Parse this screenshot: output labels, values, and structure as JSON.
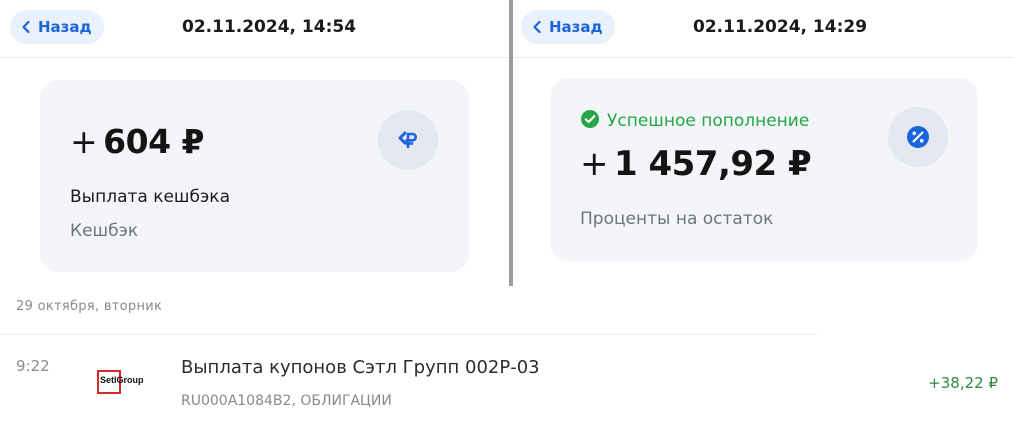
{
  "left_receipt": {
    "back_label": "Назад",
    "datetime": "02.11.2024, 14:54",
    "amount_sign": "+",
    "amount": "604 ₽",
    "icon": "cashback-ruble-icon",
    "description": "Выплата кешбэка",
    "category": "Кешбэк"
  },
  "right_receipt": {
    "back_label": "Назад",
    "datetime": "02.11.2024, 14:29",
    "status": "Успешное пополнение",
    "amount_sign": "+",
    "amount": "1 457,92 ₽",
    "icon": "percent-icon",
    "description": "Проценты на остаток"
  },
  "history": {
    "date_header": "29 октября, вторник",
    "transaction": {
      "time": "9:22",
      "logo_text": "SetlGroup",
      "title": "Выплата купонов Сэтл Групп 002Р-03",
      "subtitle": "RU000A1084B2, ОБЛИГАЦИИ",
      "amount": "+38,22 ₽"
    }
  },
  "colors": {
    "accent": "#1c64d9",
    "back_bg": "#e9f1fd",
    "card_bg": "#f3f5f9",
    "success": "#27a648",
    "income": "#2e8b3d",
    "logo_red": "#d72a2a"
  }
}
